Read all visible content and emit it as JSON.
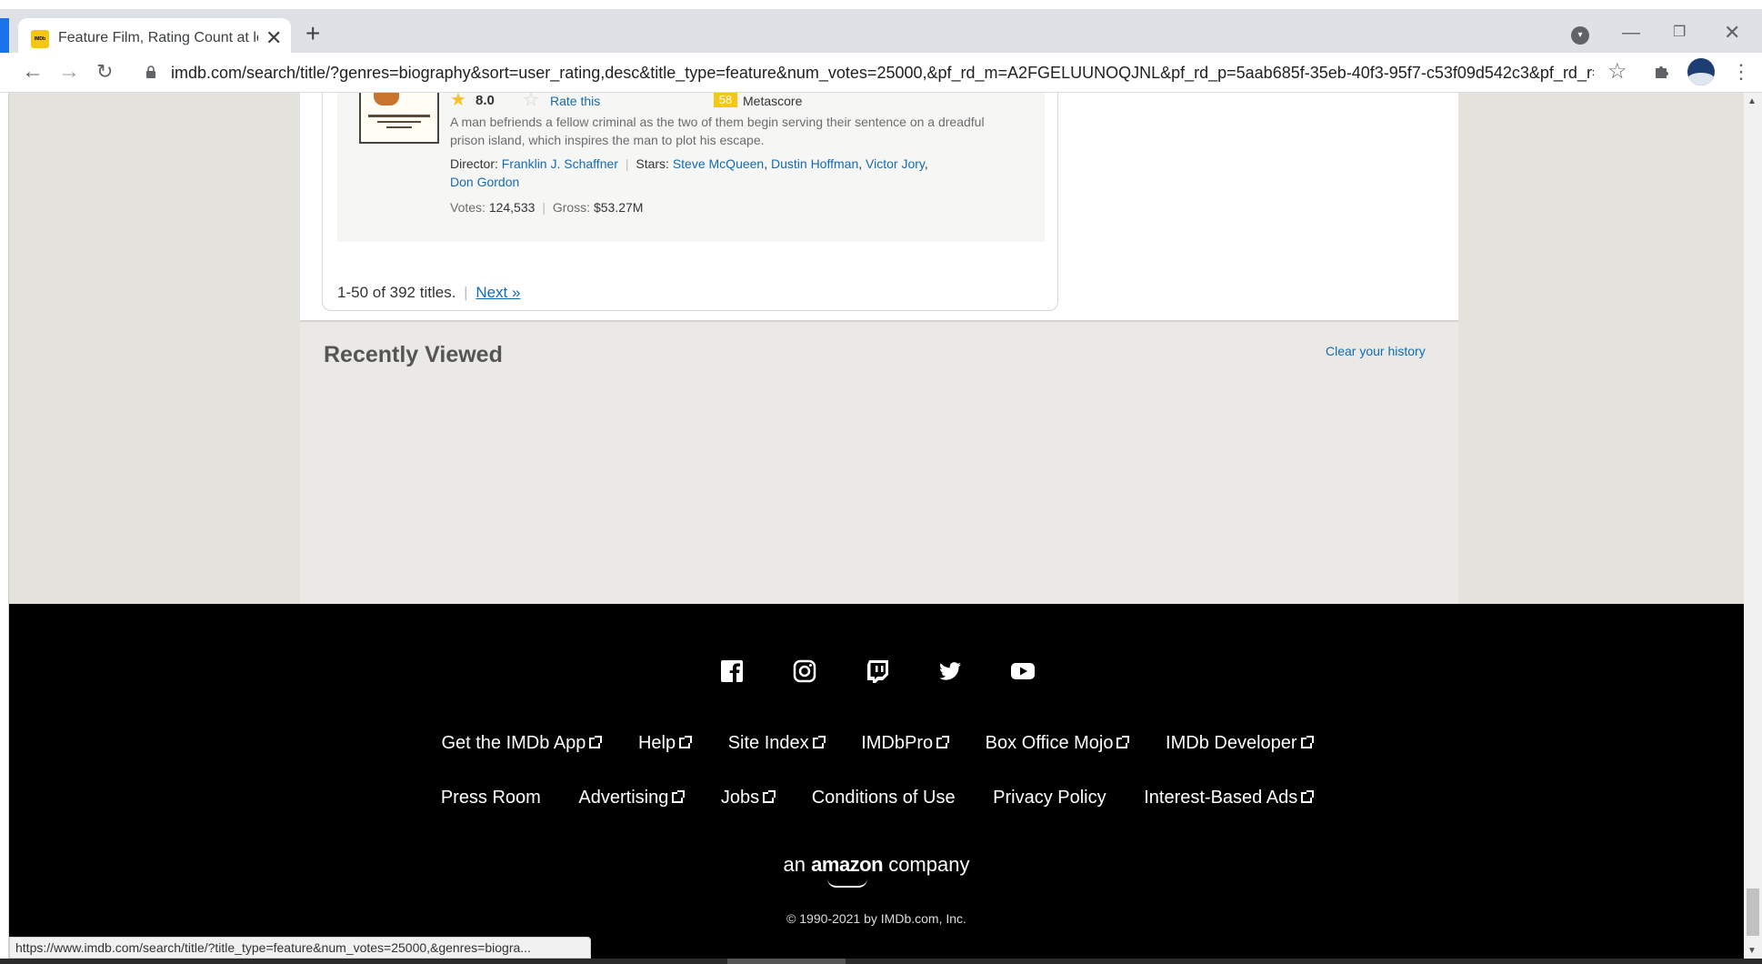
{
  "browser": {
    "tab_title": "Feature Film, Rating Count at lea",
    "tab_favicon": "IMDb",
    "url": "imdb.com/search/title/?genres=biography&sort=user_rating,desc&title_type=feature&num_votes=25000,&pf_rd_m=A2FGELUUNOQJNL&pf_rd_p=5aab685f-35eb-40f3-95f7-c53f09d542c3&pf_rd_r=A...",
    "status_url": "https://www.imdb.com/search/title/?title_type=feature&num_votes=25000,&genres=biogra..."
  },
  "film": {
    "rating": "8.0",
    "rate_label": "Rate this",
    "metascore": "58",
    "metascore_label": "Metascore",
    "description": "A man befriends a fellow criminal as the two of them begin serving their sentence on a dreadful prison island, which inspires the man to plot his escape.",
    "director_label": "Director:",
    "director": "Franklin J. Schaffner",
    "stars_label": "Stars:",
    "stars": [
      "Steve McQueen",
      "Dustin Hoffman",
      "Victor Jory",
      "Don Gordon"
    ],
    "votes_label": "Votes:",
    "votes": "124,533",
    "gross_label": "Gross:",
    "gross": "$53.27M"
  },
  "pagination": {
    "range_text": "1-50 of 392 titles.",
    "next_label": "Next »"
  },
  "recently_viewed": {
    "title": "Recently Viewed",
    "clear_label": "Clear your history"
  },
  "footer": {
    "social_icons": [
      "facebook-icon",
      "instagram-icon",
      "twitch-icon",
      "twitter-icon",
      "youtube-icon"
    ],
    "row1": [
      "Get the IMDb App",
      "Help",
      "Site Index",
      "IMDbPro",
      "Box Office Mojo",
      "IMDb Developer"
    ],
    "row2": [
      "Press Room",
      "Advertising",
      "Jobs",
      "Conditions of Use",
      "Privacy Policy",
      "Interest-Based Ads"
    ],
    "amazon_prefix": "an",
    "amazon_brand": "amazon",
    "amazon_suffix": "company",
    "copyright": "© 1990-2021 by IMDb.com, Inc."
  },
  "colors": {
    "imdb_yellow": "#f5c518",
    "link_blue": "#136cb2",
    "footer_bg": "#000000"
  }
}
